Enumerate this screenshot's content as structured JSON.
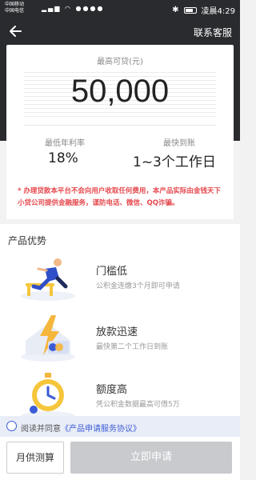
{
  "status_bar": {
    "carrier_1": "中国移动",
    "carrier_2": "中国电信",
    "time": "凌晨4:29"
  },
  "nav": {
    "service_label": "联系客服"
  },
  "loan": {
    "max_amount_label": "最高可贷(元)",
    "max_amount": "50,000",
    "rate_label": "最低年利率",
    "rate_value": "18%",
    "arrival_label": "最快到账",
    "arrival_value": "1~3个工作日",
    "notice": "* 办理贷款本平台不会向用户收取任何费用，本产品实际由金钱天下小贷公司提供金融服务，谨防电话、微信、QQ诈骗。"
  },
  "advantages": {
    "title": "产品优势",
    "items": [
      {
        "name": "门槛低",
        "desc": "公积金连缴3个月即可申请"
      },
      {
        "name": "放款迅速",
        "desc": "最快第二个工作日到账"
      },
      {
        "name": "额度高",
        "desc": "凭公积金数据最高可借5万"
      }
    ]
  },
  "agreement": {
    "prefix": "阅读并同意",
    "link": "《产品申请服务协议》"
  },
  "actions": {
    "calc_label": "月供测算",
    "apply_label": "立即申请"
  }
}
